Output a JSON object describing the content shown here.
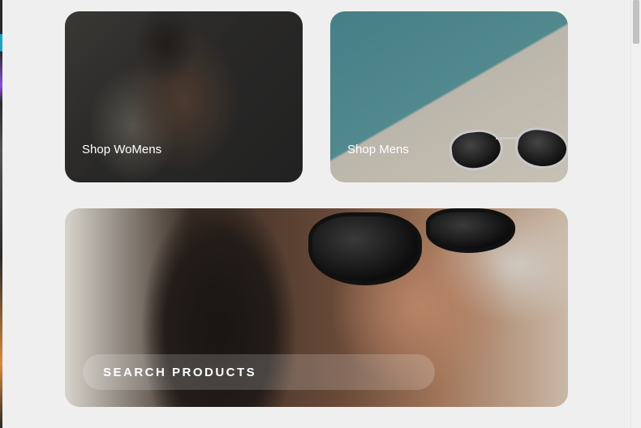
{
  "cards": {
    "women": {
      "label": "Shop WoMens"
    },
    "men": {
      "label": "Shop Mens"
    },
    "search": {
      "label": "SEARCH PRODUCTS"
    }
  }
}
